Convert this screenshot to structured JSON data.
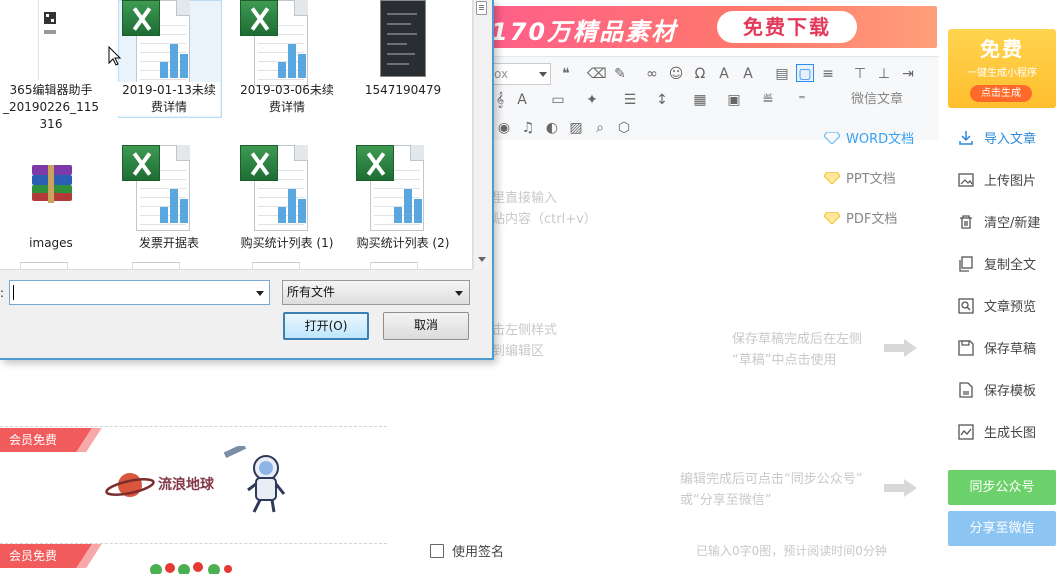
{
  "banner": {
    "text": "170万精品素材",
    "button": "免费下载"
  },
  "toolbar": {
    "font_select": "ox"
  },
  "doc_types": [
    "微信文章",
    "WORD文档",
    "PPT文档",
    "PDF文档"
  ],
  "hints": {
    "paste": [
      "里直接输入",
      "贴内容（ctrl+v）"
    ],
    "style": [
      "击左侧样式",
      "到编辑区"
    ],
    "draft": [
      "保存草稿完成后在左侧",
      "“草稿”中点击使用"
    ],
    "sync": [
      "编辑完成后可点击“同步公众号”",
      "或“分享至微信”"
    ]
  },
  "mini_ad": {
    "title": "免费",
    "subtitle": "一键生成小程序",
    "button": "点击生成"
  },
  "side_actions": [
    "导入文章",
    "上传图片",
    "清空/新建",
    "复制全文",
    "文章预览",
    "保存草稿",
    "保存模板",
    "生成长图"
  ],
  "buttons": {
    "sync": "同步公众号",
    "share": "分享至微信"
  },
  "signature": "使用签名",
  "status": "已输入0字0图，预计阅读时间0分钟",
  "materials": {
    "tag": "会员免费",
    "earth_title": "流浪地球"
  },
  "dialog": {
    "files": [
      {
        "name": "365编辑器助手_20190226_115316",
        "lines": [
          "365编辑器助手",
          "_20190226_115",
          "316"
        ]
      },
      {
        "name": "2019-01-13未续费详情",
        "lines": [
          "2019-01-13未续",
          "费详情"
        ]
      },
      {
        "name": "2019-03-06未续费详情",
        "lines": [
          "2019-03-06未续",
          "费详情"
        ]
      },
      {
        "name": "1547190479",
        "lines": [
          "1547190479"
        ]
      },
      {
        "name": "images",
        "lines": [
          "images"
        ]
      },
      {
        "name": "发票开据表",
        "lines": [
          "发票开据表"
        ]
      },
      {
        "name": "购买统计列表 (1)",
        "lines": [
          "购买统计列表 (1)"
        ]
      },
      {
        "name": "购买统计列表 (2)",
        "lines": [
          "购买统计列表 (2)"
        ]
      }
    ],
    "filename_label": ":",
    "filename_value": "",
    "filetype": "所有文件",
    "open": "打开(O)",
    "cancel": "取消"
  },
  "colors": {
    "accent": "#2b88d8",
    "sync": "#6cd16b",
    "share": "#8cc4f2",
    "vip": "#f25b5b",
    "banner": "#ff5e8a"
  }
}
